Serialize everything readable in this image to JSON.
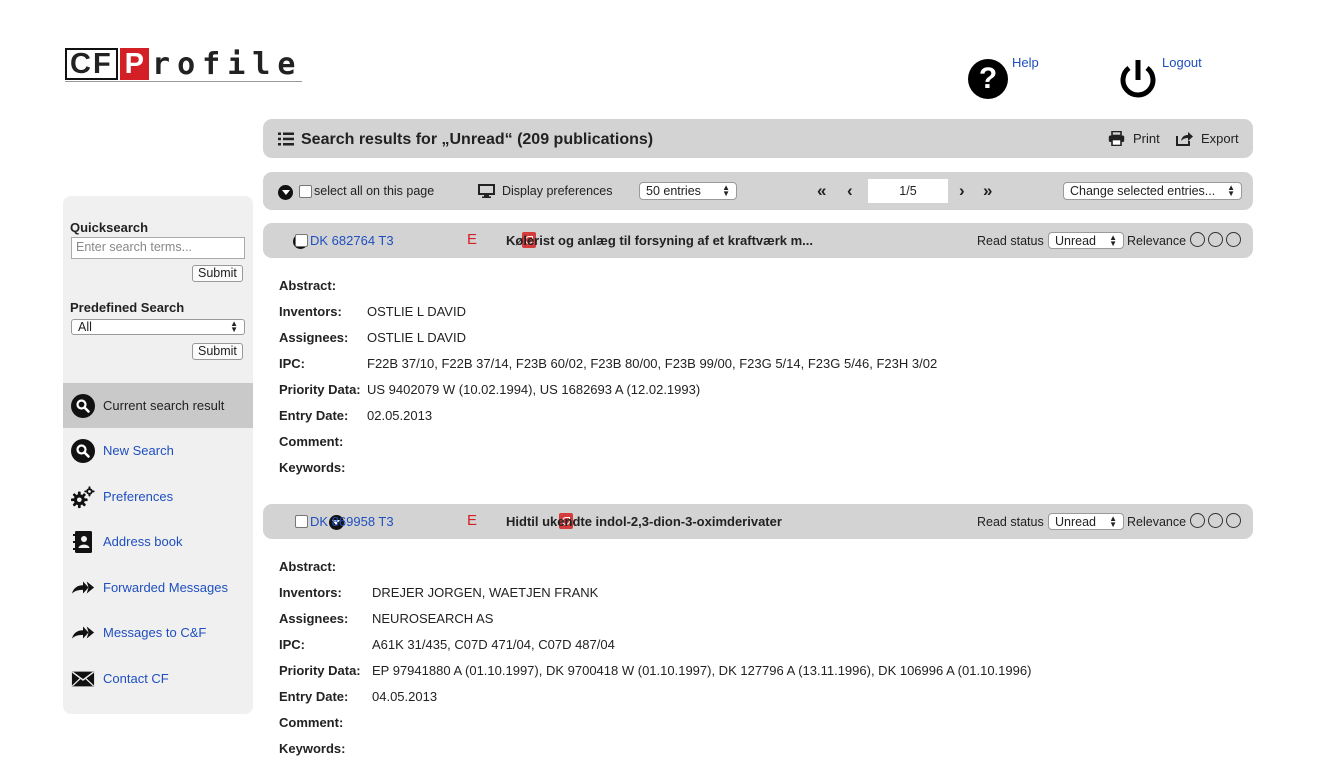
{
  "logo": {
    "cf": "CF",
    "p": "P",
    "rest": "rofile"
  },
  "top": {
    "help": "Help",
    "logout": "Logout"
  },
  "header": {
    "title": "Search results for „Unread“ (209 publications)",
    "print": "Print",
    "export": "Export"
  },
  "toolbar": {
    "select_all": "select all on this page",
    "display_prefs": "Display preferences",
    "entries": "50 entries",
    "page": "1/5",
    "change": "Change selected entries..."
  },
  "sidebar": {
    "quicksearch_label": "Quicksearch",
    "quicksearch_placeholder": "Enter search terms...",
    "submit": "Submit",
    "predefined_label": "Predefined Search",
    "predefined_value": "All",
    "nav": [
      {
        "label": "Current search result",
        "icon": "search-icon"
      },
      {
        "label": "New Search",
        "icon": "search-icon"
      },
      {
        "label": "Preferences",
        "icon": "gears-icon"
      },
      {
        "label": "Address book",
        "icon": "address-book-icon"
      },
      {
        "label": "Forwarded Messages",
        "icon": "forward-icon"
      },
      {
        "label": "Messages to C&F",
        "icon": "forward-icon"
      },
      {
        "label": "Contact CF",
        "icon": "envelope-icon"
      }
    ]
  },
  "labels": {
    "abstract": "Abstract:",
    "inventors": "Inventors:",
    "assignees": "Assignees:",
    "ipc": "IPC:",
    "priority": "Priority Data:",
    "entry_date": "Entry Date:",
    "comment": "Comment:",
    "keywords": "Keywords:",
    "read_status": "Read status",
    "relevance": "Relevance",
    "e": "E"
  },
  "records": [
    {
      "id": "DK 682764 T3",
      "title": "Kølerist og anlæg til forsyning af et kraftværk m...",
      "read_status": "Unread",
      "abstract": "",
      "inventors": "OSTLIE L DAVID",
      "assignees": "OSTLIE L DAVID",
      "ipc": "F22B 37/10, F22B 37/14, F23B 60/02, F23B 80/00, F23B 99/00, F23G 5/14, F23G 5/46, F23H 3/02",
      "priority": "US 9402079 W (10.02.1994), US 1682693 A (12.02.1993)",
      "entry_date": "02.05.2013",
      "comment": "",
      "keywords": ""
    },
    {
      "id": "DK 869958 T3",
      "title": "Hidtil ukendte indol-2,3-dion-3-oximderivater",
      "read_status": "Unread",
      "abstract": "",
      "inventors": "DREJER JORGEN, WAETJEN FRANK",
      "assignees": "NEUROSEARCH AS",
      "ipc": "A61K 31/435, C07D 471/04, C07D 487/04",
      "priority": "EP 97941880 A (01.10.1997), DK 9700418 W (01.10.1997), DK 127796 A (13.11.1996), DK 106996 A (01.10.1996)",
      "entry_date": "04.05.2013",
      "comment": "",
      "keywords": ""
    }
  ]
}
